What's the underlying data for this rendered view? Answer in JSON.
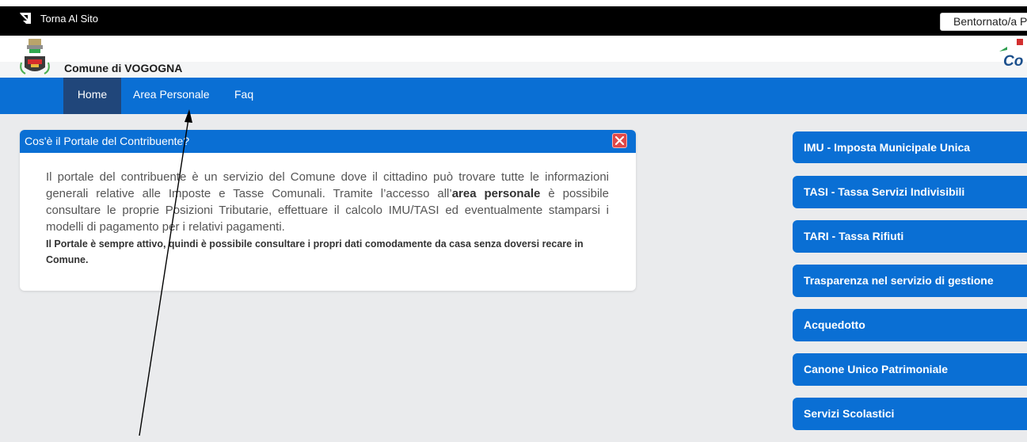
{
  "topbar": {
    "back_label": "Torna Al Sito",
    "welcome_text": "Bentornato/a P"
  },
  "header": {
    "comune_name": "Comune di VOGOGNA",
    "right_logo_text": "Co"
  },
  "nav": {
    "items": [
      "Home",
      "Area Personale",
      "Faq"
    ],
    "active": "Home"
  },
  "info_panel": {
    "title": "Cos'è il Portale del Contribuente?",
    "text_before": "Il portale del contribuente è un servizio del Comune dove il cittadino può trovare tutte le informazioni generali relative alle Imposte e Tasse Comunali. Tramite l’accesso all’",
    "text_bold": "area personale",
    "text_after": " è possibile consultare le proprie Posizioni Tributarie, effettuare il calcolo IMU/TASI ed eventualmente stamparsi i modelli di pagamento per i relativi pagamenti.",
    "note": "Il Portale è sempre attivo, quindi è possibile consultare i propri dati comodamente da casa senza doversi recare in Comune."
  },
  "sidebar": {
    "items": [
      "IMU - Imposta Municipale Unica",
      "TASI - Tassa Servizi Indivisibili",
      "TARI - Tassa Rifiuti",
      "Trasparenza nel servizio di gestione",
      "Acquedotto",
      "Canone Unico Patrimoniale",
      "Servizi Scolastici"
    ]
  },
  "colors": {
    "accent_blue": "#0a6fd4",
    "nav_active": "#20467a",
    "topbar": "#000000",
    "close_red": "#e04848"
  },
  "icons": {
    "back": "back-arrow-icon",
    "close": "close-icon",
    "crest": "municipal-crest-icon"
  }
}
